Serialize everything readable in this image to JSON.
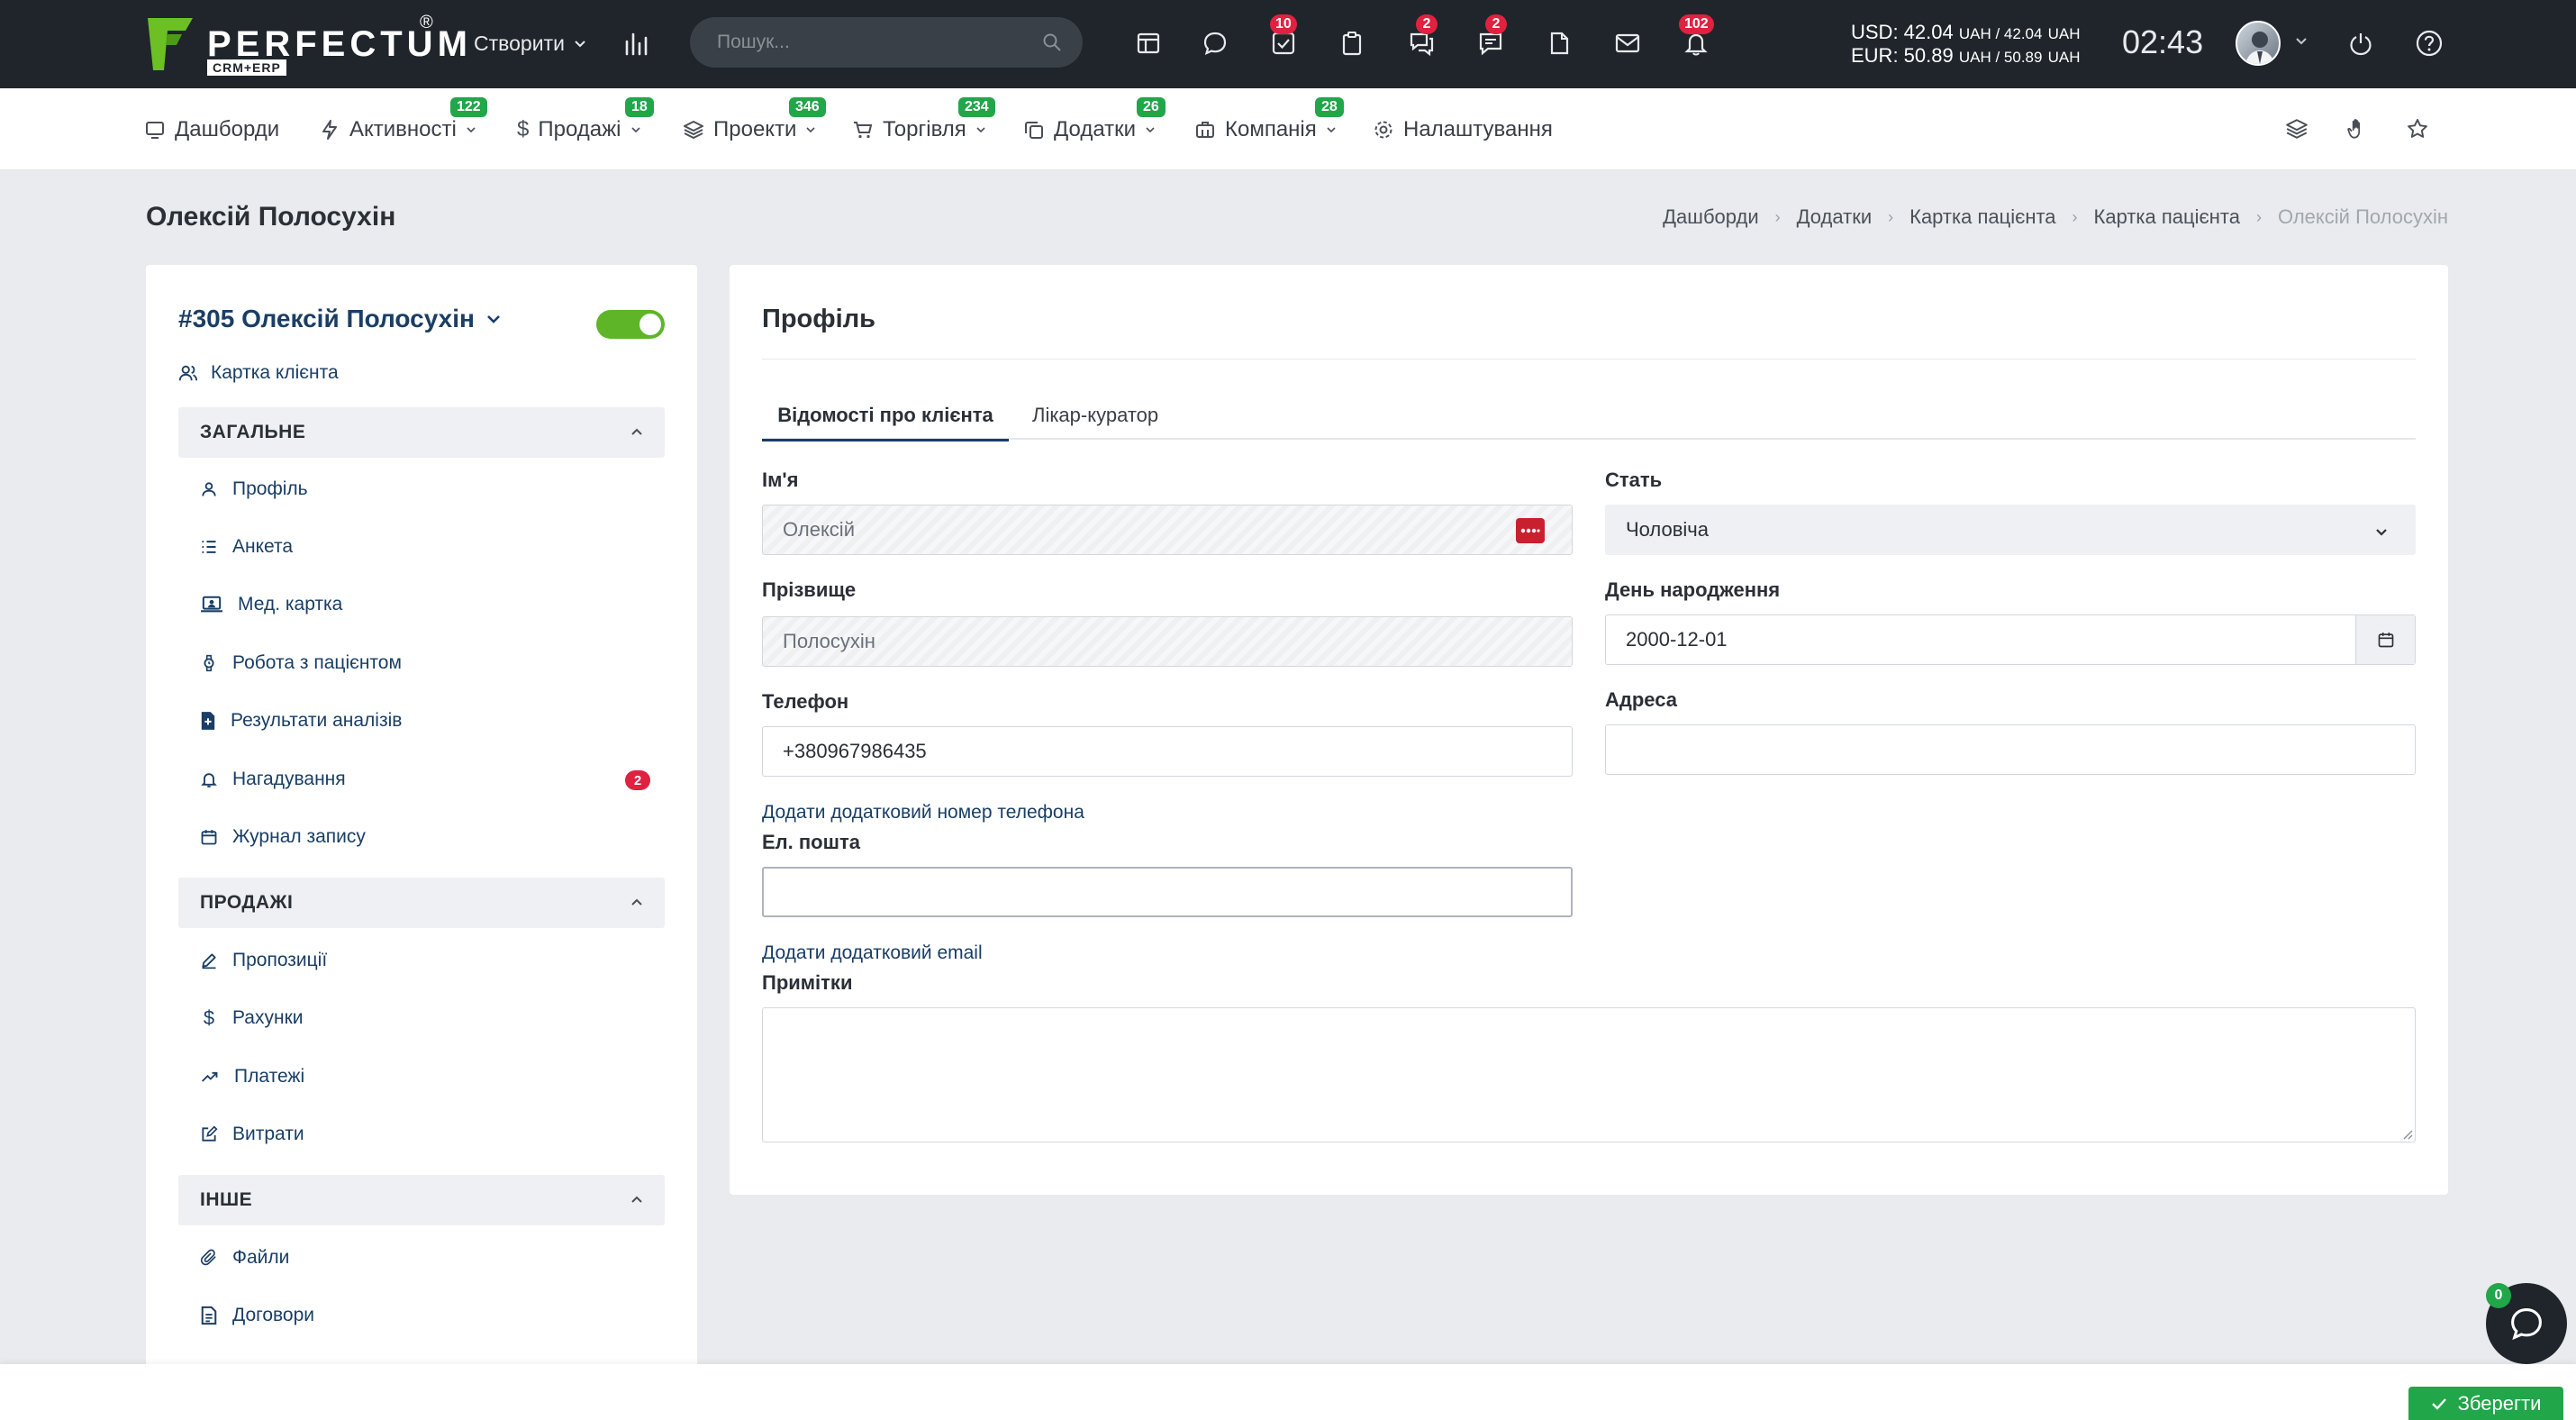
{
  "topbar": {
    "logo_text": "PERFECTUM",
    "logo_sub": "CRM+ERP",
    "logo_reg": "®",
    "create_label": "Створити",
    "search_placeholder": "Пошук...",
    "badges": {
      "tasks": "10",
      "chat": "2",
      "messages": "2",
      "notifications": "102"
    },
    "rates": {
      "usd_line": "USD: 42.04",
      "usd_tail": "UAH / 42.04",
      "usd_unit": "UAH",
      "eur_line": "EUR: 50.89",
      "eur_tail": "UAH / 50.89",
      "eur_unit": "UAH"
    },
    "clock": "02:43"
  },
  "nav": {
    "items": [
      {
        "label": "Дашборди",
        "badge": ""
      },
      {
        "label": "Активності",
        "badge": "122"
      },
      {
        "label": "Продажі",
        "badge": "18"
      },
      {
        "label": "Проекти",
        "badge": "346"
      },
      {
        "label": "Торгівля",
        "badge": "234"
      },
      {
        "label": "Додатки",
        "badge": "26"
      },
      {
        "label": "Компанія",
        "badge": "28"
      },
      {
        "label": "Налаштування",
        "badge": ""
      }
    ]
  },
  "page": {
    "title": "Олексій Полосухін",
    "breadcrumb": [
      "Дашборди",
      "Додатки",
      "Картка пацієнта",
      "Картка пацієнта",
      "Олексій Полосухін"
    ]
  },
  "sidebar": {
    "client_title": "#305 Олексій Полосухін",
    "client_card_link": "Картка клієнта",
    "sections": [
      {
        "title": "ЗАГАЛЬНЕ",
        "items": [
          {
            "label": "Профіль",
            "badge": ""
          },
          {
            "label": "Анкета",
            "badge": ""
          },
          {
            "label": "Мед. картка",
            "badge": ""
          },
          {
            "label": "Робота з пацієнтом",
            "badge": ""
          },
          {
            "label": "Результати аналізів",
            "badge": ""
          },
          {
            "label": "Нагадування",
            "badge": "2"
          },
          {
            "label": "Журнал запису",
            "badge": ""
          }
        ]
      },
      {
        "title": "ПРОДАЖІ",
        "items": [
          {
            "label": "Пропозиції"
          },
          {
            "label": "Рахунки"
          },
          {
            "label": "Платежі"
          },
          {
            "label": "Витрати"
          }
        ]
      },
      {
        "title": "ІНШЕ",
        "items": [
          {
            "label": "Файли"
          },
          {
            "label": "Договори"
          }
        ]
      }
    ]
  },
  "profile": {
    "title": "Профіль",
    "tabs": [
      "Відомості про клієнта",
      "Лікар-куратор"
    ],
    "fields": {
      "first_name": {
        "label": "Ім'я",
        "value": "Олексій"
      },
      "gender": {
        "label": "Стать",
        "value": "Чоловіча"
      },
      "last_name": {
        "label": "Прізвище",
        "value": "Полосухін"
      },
      "birthday": {
        "label": "День народження",
        "value": "2000-12-01"
      },
      "phone": {
        "label": "Телефон",
        "value": "+380967986435"
      },
      "address": {
        "label": "Адреса",
        "value": ""
      },
      "email": {
        "label": "Ел. пошта",
        "value": ""
      },
      "notes": {
        "label": "Примітки",
        "value": ""
      }
    },
    "add_phone_link": "Додати додатковий номер телефона",
    "add_email_link": "Додати додатковий email"
  },
  "footer": {
    "save_label": "Зберегти",
    "chat_badge": "0"
  },
  "colors": {
    "topbar_bg": "#1f252b",
    "accent_green": "#21a649",
    "badge_red": "#e0213f",
    "link_blue": "#1a3e66",
    "toggle_green": "#5fb528"
  }
}
